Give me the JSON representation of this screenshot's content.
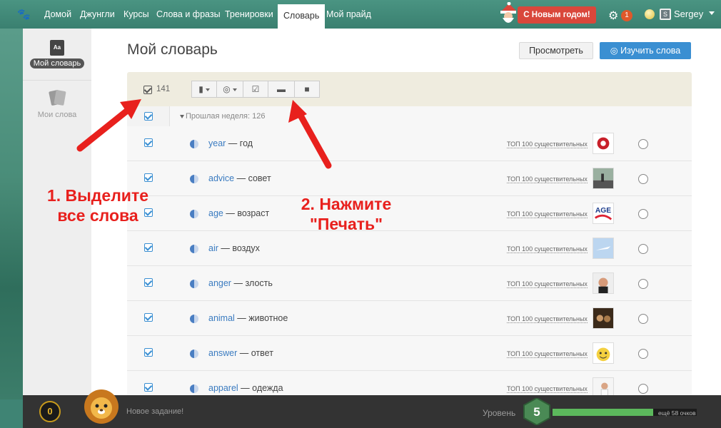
{
  "nav": {
    "items": [
      "Домой",
      "Джунгли",
      "Курсы",
      "Слова и фразы",
      "Тренировки",
      "Словарь",
      "Мой прайд"
    ],
    "active": "Словарь",
    "new_year_badge": "С Новым годом!",
    "notification_count": "1",
    "username": "Sergey"
  },
  "sidebar": {
    "items": [
      {
        "label": "Мой словарь",
        "icon": "Aa"
      },
      {
        "label": "Мои слова"
      }
    ]
  },
  "header": {
    "title": "Мой словарь",
    "view_button": "Просмотреть",
    "learn_button": "Изучить слова"
  },
  "toolbar": {
    "selected_count": "141"
  },
  "list": {
    "group_label": "Прошлая неделя: 126",
    "rows": [
      {
        "word": "year",
        "translation": "год",
        "tag": "ТОП 100 существительных"
      },
      {
        "word": "advice",
        "translation": "совет",
        "tag": "ТОП 100 существительных"
      },
      {
        "word": "age",
        "translation": "возраст",
        "tag": "ТОП 100 существительных"
      },
      {
        "word": "air",
        "translation": "воздух",
        "tag": "ТОП 100 существительных"
      },
      {
        "word": "anger",
        "translation": "злость",
        "tag": "ТОП 100 существительных"
      },
      {
        "word": "animal",
        "translation": "животное",
        "tag": "ТОП 100 существительных"
      },
      {
        "word": "answer",
        "translation": "ответ",
        "tag": "ТОП 100 существительных"
      },
      {
        "word": "apparel",
        "translation": "одежда",
        "tag": "ТОП 100 существительных"
      }
    ],
    "thumb_text_age": "AGE"
  },
  "annotations": {
    "step1_line1": "1. Выделите",
    "step1_line2": "все слова",
    "step2_line1": "2. Нажмите",
    "step2_line2": "\"Печать\""
  },
  "bottombar": {
    "coins": "0",
    "task_text": "Новое задание!",
    "level_label": "Уровень",
    "level": "5",
    "progress": 0.7,
    "points_text": "ещё 58 очков"
  },
  "colors": {
    "accent": "#3a8fd2",
    "nav_bg": "#3f8474",
    "annotation": "#e8201d",
    "progress": "#5cb85c"
  }
}
